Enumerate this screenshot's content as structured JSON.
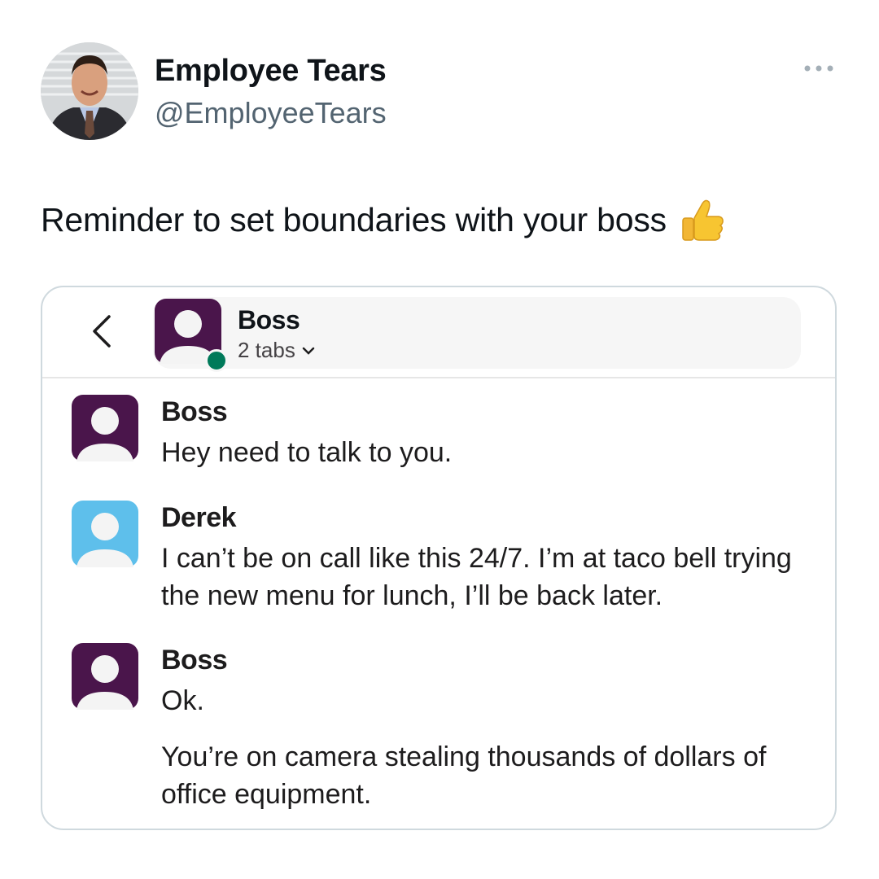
{
  "tweet": {
    "display_name": "Employee Tears",
    "handle": "@EmployeeTears",
    "text": "Reminder to set boundaries with your boss",
    "emoji": "thumbs-up-icon",
    "avatar": "profile-photo"
  },
  "chat": {
    "header": {
      "name": "Boss",
      "subtitle": "2 tabs",
      "status": "online",
      "status_color": "#007a5a"
    },
    "messages": [
      {
        "author": "Boss",
        "avatar_color": "#4a154b",
        "lines": [
          "Hey need to talk to you."
        ]
      },
      {
        "author": "Derek",
        "avatar_color": "#5ebfeb",
        "lines": [
          "I can’t be on call like this 24/7. I’m at taco bell trying the new menu for lunch, I’ll be back later."
        ]
      },
      {
        "author": "Boss",
        "avatar_color": "#4a154b",
        "lines": [
          "Ok.",
          "You’re on camera stealing thousands of dollars of office equipment."
        ]
      }
    ]
  },
  "colors": {
    "boss_avatar": "#4a154b",
    "derek_avatar": "#5ebfeb",
    "handle_text": "#536471"
  }
}
